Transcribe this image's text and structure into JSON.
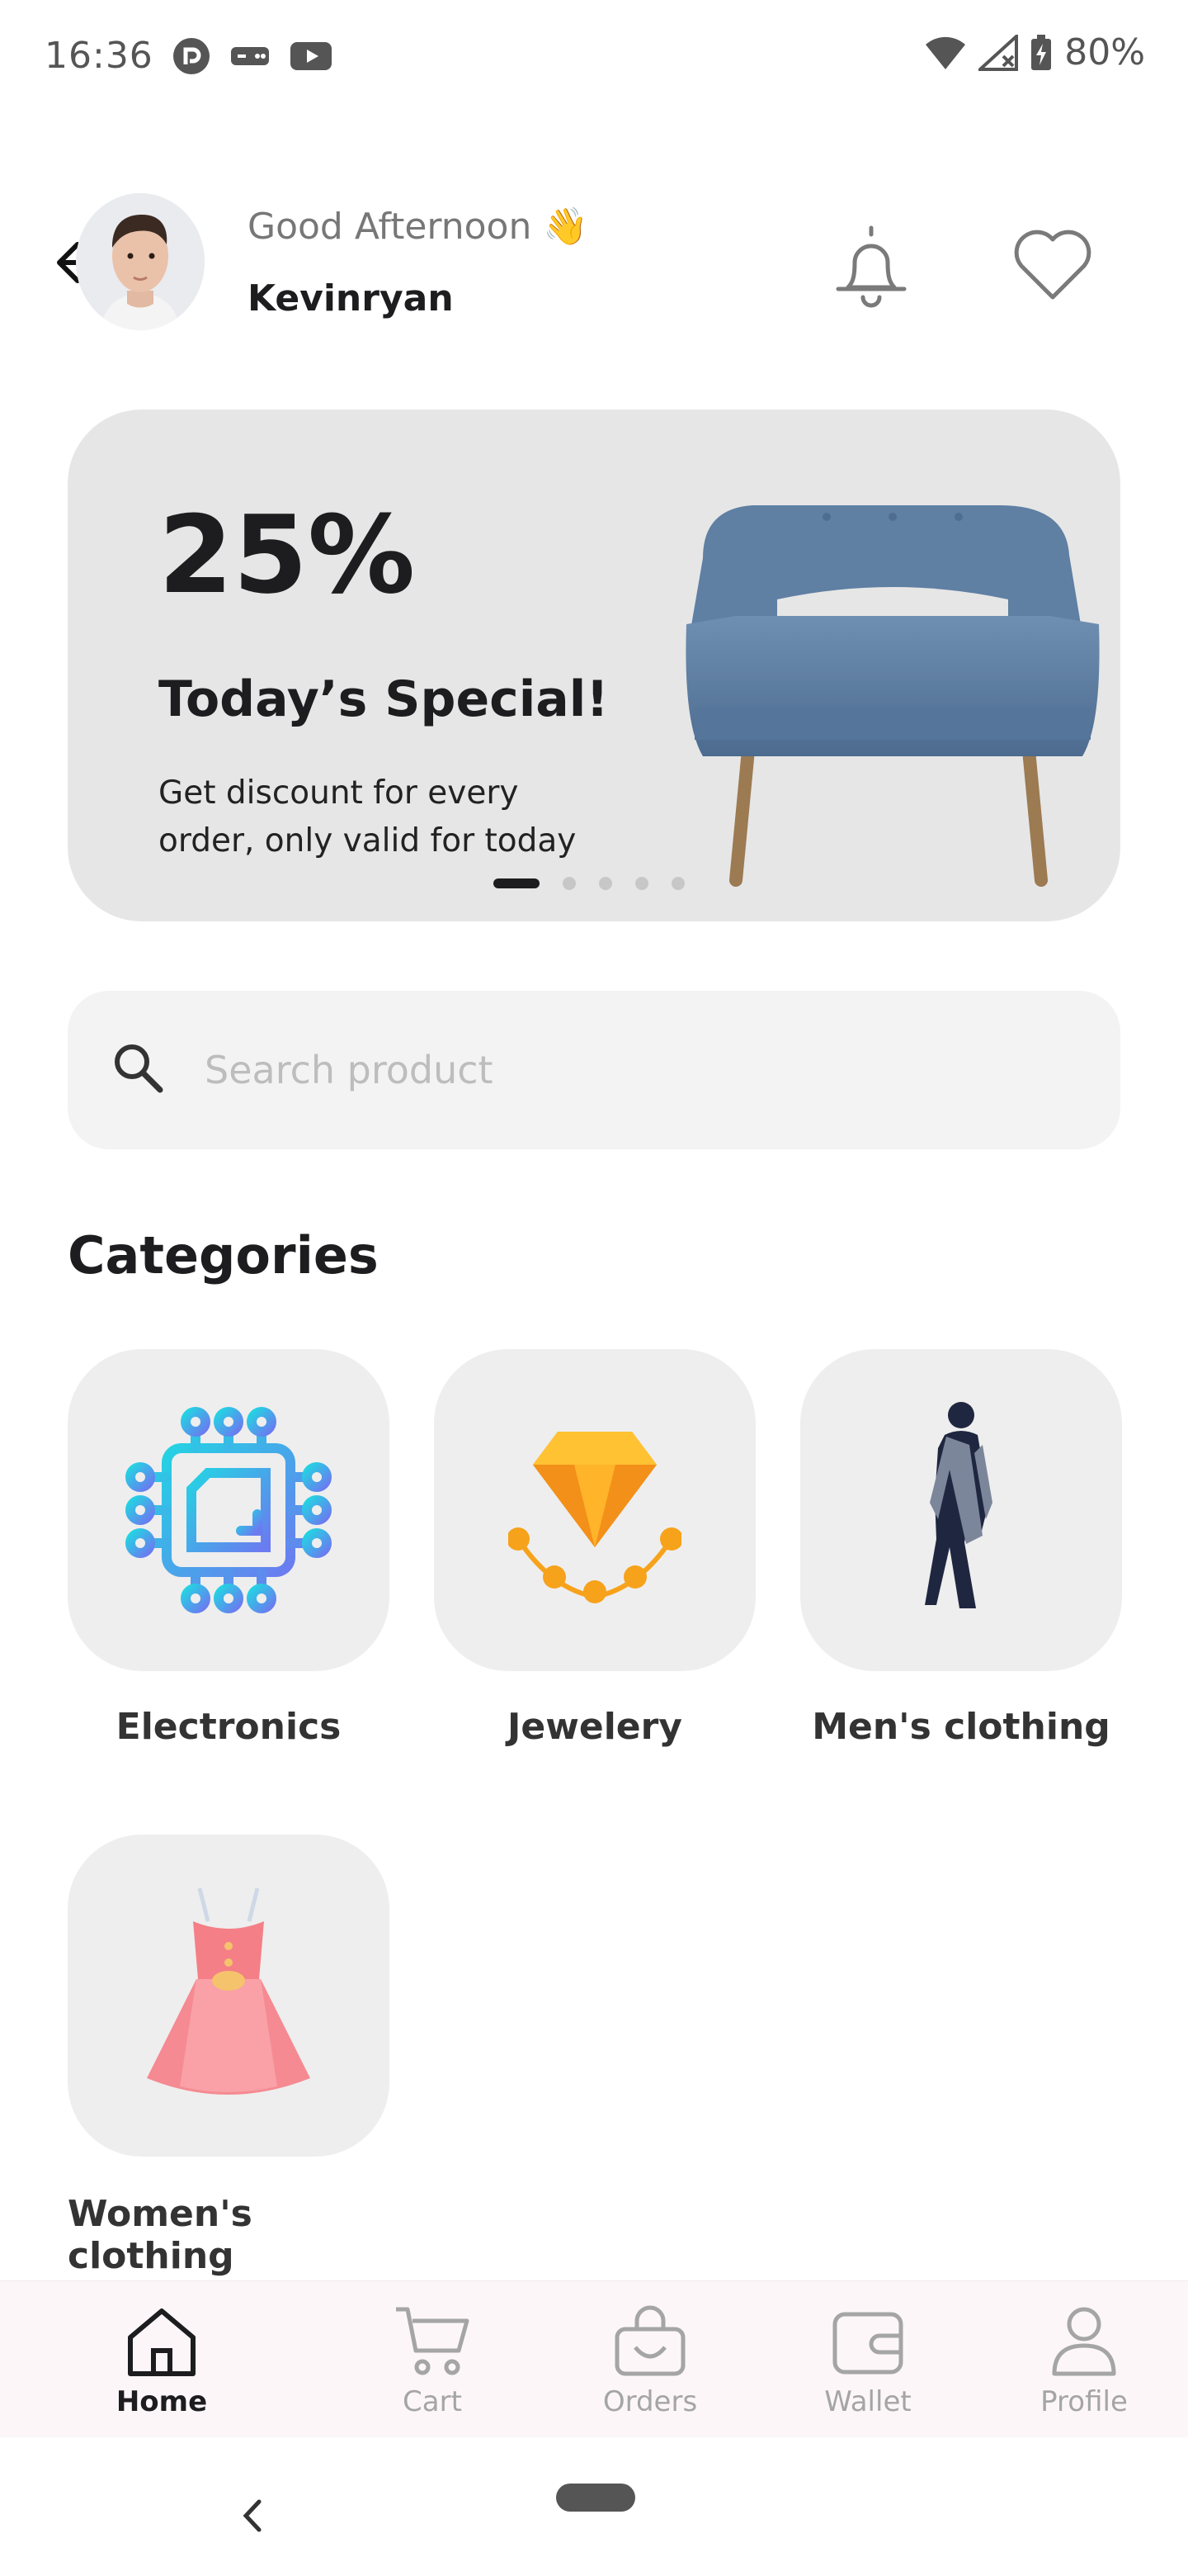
{
  "status_bar": {
    "time": "16:36",
    "battery": "80%",
    "left_icons": [
      "pocket-casts-icon",
      "gamepad-icon",
      "youtube-icon"
    ],
    "right_icons": [
      "wifi-icon",
      "no-signal-icon",
      "battery-charging-icon"
    ]
  },
  "header": {
    "greeting": "Good Afternoon 👋",
    "username": "Kevinryan",
    "back_icon": "arrow-left-icon",
    "notification_icon": "bell-icon",
    "wishlist_icon": "heart-icon"
  },
  "banner": {
    "discount": "25%",
    "title": "Today’s Special!",
    "description": "Get discount for every order, only valid for today",
    "image": "armchair-image",
    "carousel_total": 5,
    "carousel_active": 1,
    "background": "#e6e6e6"
  },
  "search": {
    "placeholder": "Search product",
    "value": ""
  },
  "categories": {
    "title": "Categories",
    "items": [
      {
        "label": "Electronics",
        "icon": "microchip-icon"
      },
      {
        "label": "Jewelery",
        "icon": "diamond-necklace-icon"
      },
      {
        "label": "Men's clothing",
        "icon": "walking-man-icon"
      },
      {
        "label": "Women's clothing",
        "icon": "dress-icon"
      }
    ]
  },
  "bottom_nav": {
    "items": [
      {
        "label": "Home",
        "icon": "home-icon",
        "active": true
      },
      {
        "label": "Cart",
        "icon": "cart-icon",
        "active": false
      },
      {
        "label": "Orders",
        "icon": "shopping-bag-icon",
        "active": false
      },
      {
        "label": "Wallet",
        "icon": "wallet-icon",
        "active": false
      },
      {
        "label": "Profile",
        "icon": "person-icon",
        "active": false
      }
    ]
  },
  "colors": {
    "primary_text": "#1d1d1f",
    "muted_text": "#a5a5a5",
    "surface": "#eeeeee",
    "nav_background": "#fcf6f9"
  }
}
